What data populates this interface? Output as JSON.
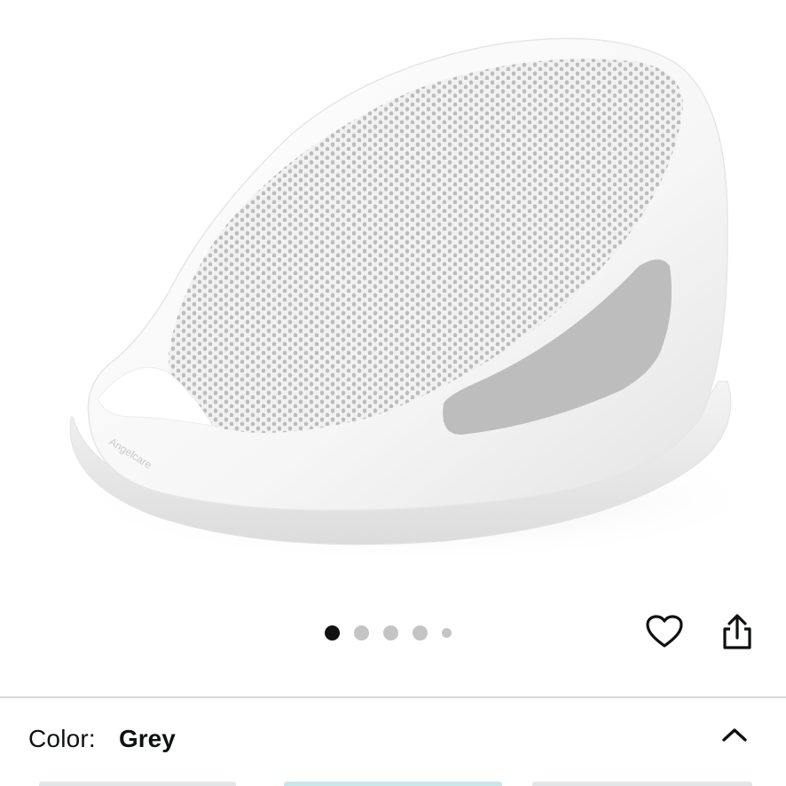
{
  "product": {
    "image_alt": "Angelcare baby bath support",
    "brand_mark": "Angelcare"
  },
  "carousel": {
    "total": 5,
    "active_index": 0
  },
  "actions": {
    "wishlist_icon": "heart-icon",
    "share_icon": "share-icon"
  },
  "variation": {
    "label": "Color:",
    "value": "Grey",
    "toggle_icon": "chevron-up-icon"
  },
  "colors": {
    "active_dot": "#111111",
    "inactive_dot": "#c4c4c4",
    "divider": "#d5d9d9",
    "text": "#0f1111"
  }
}
